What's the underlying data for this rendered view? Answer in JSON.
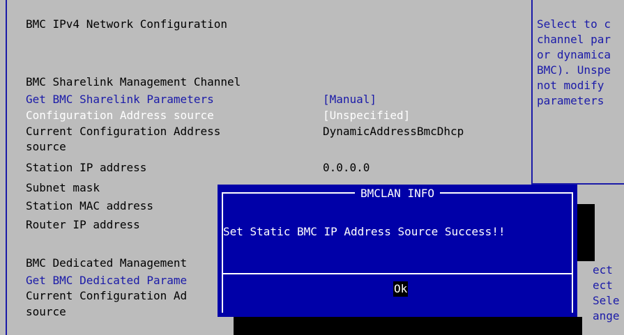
{
  "main": {
    "rows": [
      {
        "label": "BMC IPv4 Network Configuration",
        "value": ""
      },
      {
        "label": "BMC Sharelink Management Channel",
        "value": ""
      },
      {
        "label": "Get BMC Sharelink Parameters",
        "value": "[Manual]"
      },
      {
        "label": "Configuration Address source",
        "value": "[Unspecified]"
      },
      {
        "label": "Current Configuration Address",
        "value": "DynamicAddressBmcDhcp"
      },
      {
        "label": "source",
        "value": ""
      },
      {
        "label": "Station IP address",
        "value": "0.0.0.0"
      },
      {
        "label": "Subnet mask",
        "value": ""
      },
      {
        "label": "Station MAC address",
        "value": ""
      },
      {
        "label": "Router IP address",
        "value": ""
      },
      {
        "label": "BMC Dedicated Management",
        "value": ""
      },
      {
        "label": "Get BMC Dedicated Parame",
        "value": ""
      },
      {
        "label": "Current Configuration Ad",
        "value": ""
      },
      {
        "label": "source",
        "value": ""
      }
    ]
  },
  "help": {
    "lines": [
      "Select to c",
      "channel par",
      "or dynamica",
      "BMC). Unspe",
      "not modify",
      "parameters"
    ]
  },
  "side_keys": [
    "ect",
    "ect",
    "Sele",
    "ange"
  ],
  "dialog": {
    "title": "BMCLAN INFO",
    "message": "Set Static BMC IP Address Source Success!!",
    "ok_label": "Ok"
  },
  "colors": {
    "background": "#bcbcbc",
    "accent_blue": "#1a1aa8",
    "dialog_blue": "#0000a8",
    "highlight": "#ffffff"
  }
}
